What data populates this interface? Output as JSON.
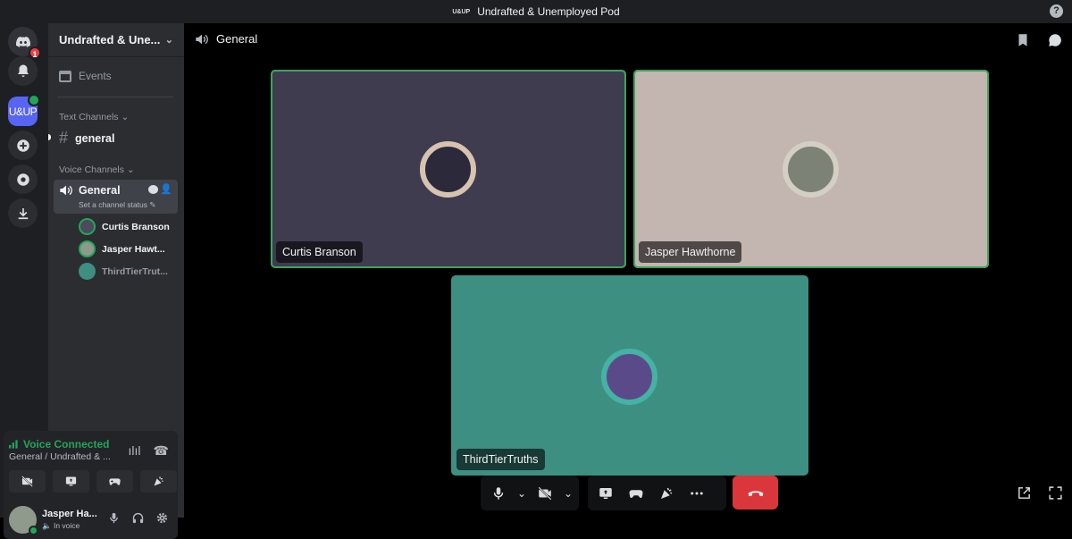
{
  "titlebar": {
    "logo_text": "U&UP",
    "title": "Undrafted & Unemployed Pod",
    "help": "?"
  },
  "guilds": {
    "dm_badge": "1",
    "server_initials": "U&UP"
  },
  "sidebar": {
    "server_name": "Undrafted & Une...",
    "events_label": "Events",
    "text_category": "Text Channels",
    "text_channel": "general",
    "voice_category": "Voice Channels",
    "voice_channel": "General",
    "channel_status": "Set a channel status",
    "voice_users": [
      "Curtis Branson",
      "Jasper Hawt...",
      "ThirdTierTrut..."
    ]
  },
  "panel": {
    "voice_connected": "Voice Connected",
    "voice_location": "General / Undrafted & ...",
    "user_name": "Jasper Ha...",
    "user_status": "In voice"
  },
  "main": {
    "channel_title": "General",
    "tiles": [
      {
        "name": "Curtis Branson",
        "bg": "#3f3c50",
        "speaking": true
      },
      {
        "name": "Jasper Hawthorne",
        "bg": "#c3b5b0",
        "speaking": true
      },
      {
        "name": "ThirdTierTruths",
        "bg": "#3d8f82",
        "speaking": false
      }
    ]
  },
  "colors": {
    "accent": "#5865f2",
    "online": "#23a559",
    "danger": "#da373c"
  }
}
